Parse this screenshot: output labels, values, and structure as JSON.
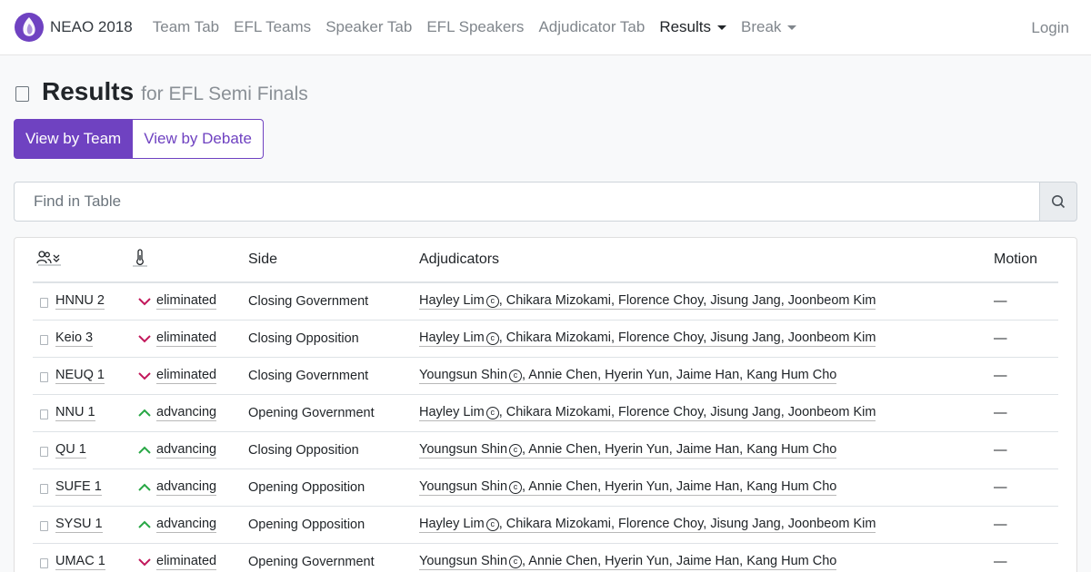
{
  "nav": {
    "brand": "NEAO 2018",
    "items": [
      {
        "label": "Team Tab"
      },
      {
        "label": "EFL Teams"
      },
      {
        "label": "Speaker Tab"
      },
      {
        "label": "EFL Speakers"
      },
      {
        "label": "Adjudicator Tab"
      },
      {
        "label": "Results",
        "active": true,
        "dropdown": true
      },
      {
        "label": "Break",
        "dropdown": true
      }
    ],
    "login": "Login"
  },
  "page": {
    "title": "Results",
    "subtitle": "for EFL Semi Finals"
  },
  "view_buttons": {
    "by_team": "View by Team",
    "by_debate": "View by Debate"
  },
  "search": {
    "placeholder": "Find in Table"
  },
  "table": {
    "headers": {
      "side": "Side",
      "adjudicators": "Adjudicators",
      "motion": "Motion"
    },
    "chair_mark": "c",
    "rows": [
      {
        "team": "HNNU 2",
        "result": "eliminated",
        "side": "Closing Government",
        "chair": "Hayley Lim",
        "panel": ", Chikara Mizokami, Florence Choy, Jisung Jang, Joonbeom Kim",
        "motion": "—"
      },
      {
        "team": "Keio 3",
        "result": "eliminated",
        "side": "Closing Opposition",
        "chair": "Hayley Lim",
        "panel": ", Chikara Mizokami, Florence Choy, Jisung Jang, Joonbeom Kim",
        "motion": "—"
      },
      {
        "team": "NEUQ 1",
        "result": "eliminated",
        "side": "Closing Government",
        "chair": "Youngsun Shin",
        "panel": ", Annie Chen, Hyerin Yun, Jaime Han, Kang Hum Cho",
        "motion": "—"
      },
      {
        "team": "NNU 1",
        "result": "advancing",
        "side": "Opening Government",
        "chair": "Hayley Lim",
        "panel": ", Chikara Mizokami, Florence Choy, Jisung Jang, Joonbeom Kim",
        "motion": "—"
      },
      {
        "team": "QU 1",
        "result": "advancing",
        "side": "Closing Opposition",
        "chair": "Youngsun Shin",
        "panel": ", Annie Chen, Hyerin Yun, Jaime Han, Kang Hum Cho",
        "motion": "—"
      },
      {
        "team": "SUFE 1",
        "result": "advancing",
        "side": "Opening Opposition",
        "chair": "Youngsun Shin",
        "panel": ", Annie Chen, Hyerin Yun, Jaime Han, Kang Hum Cho",
        "motion": "—"
      },
      {
        "team": "SYSU 1",
        "result": "advancing",
        "side": "Opening Opposition",
        "chair": "Hayley Lim",
        "panel": ", Chikara Mizokami, Florence Choy, Jisung Jang, Joonbeom Kim",
        "motion": "—"
      },
      {
        "team": "UMAC 1",
        "result": "eliminated",
        "side": "Opening Government",
        "chair": "Youngsun Shin",
        "panel": ", Annie Chen, Hyerin Yun, Jaime Han, Kang Hum Cho",
        "motion": "—"
      }
    ]
  },
  "colors": {
    "primary": "#6f42c1",
    "advancing": "#28a745",
    "eliminated": "#c2185b"
  },
  "icons": {
    "brand": "tabbycat-logo-icon",
    "title": "square-icon",
    "search": "search-icon",
    "team_column": "users-sort-icon",
    "result_column": "thermometer-icon",
    "advancing": "chevron-up-icon",
    "eliminated": "chevron-down-icon"
  }
}
